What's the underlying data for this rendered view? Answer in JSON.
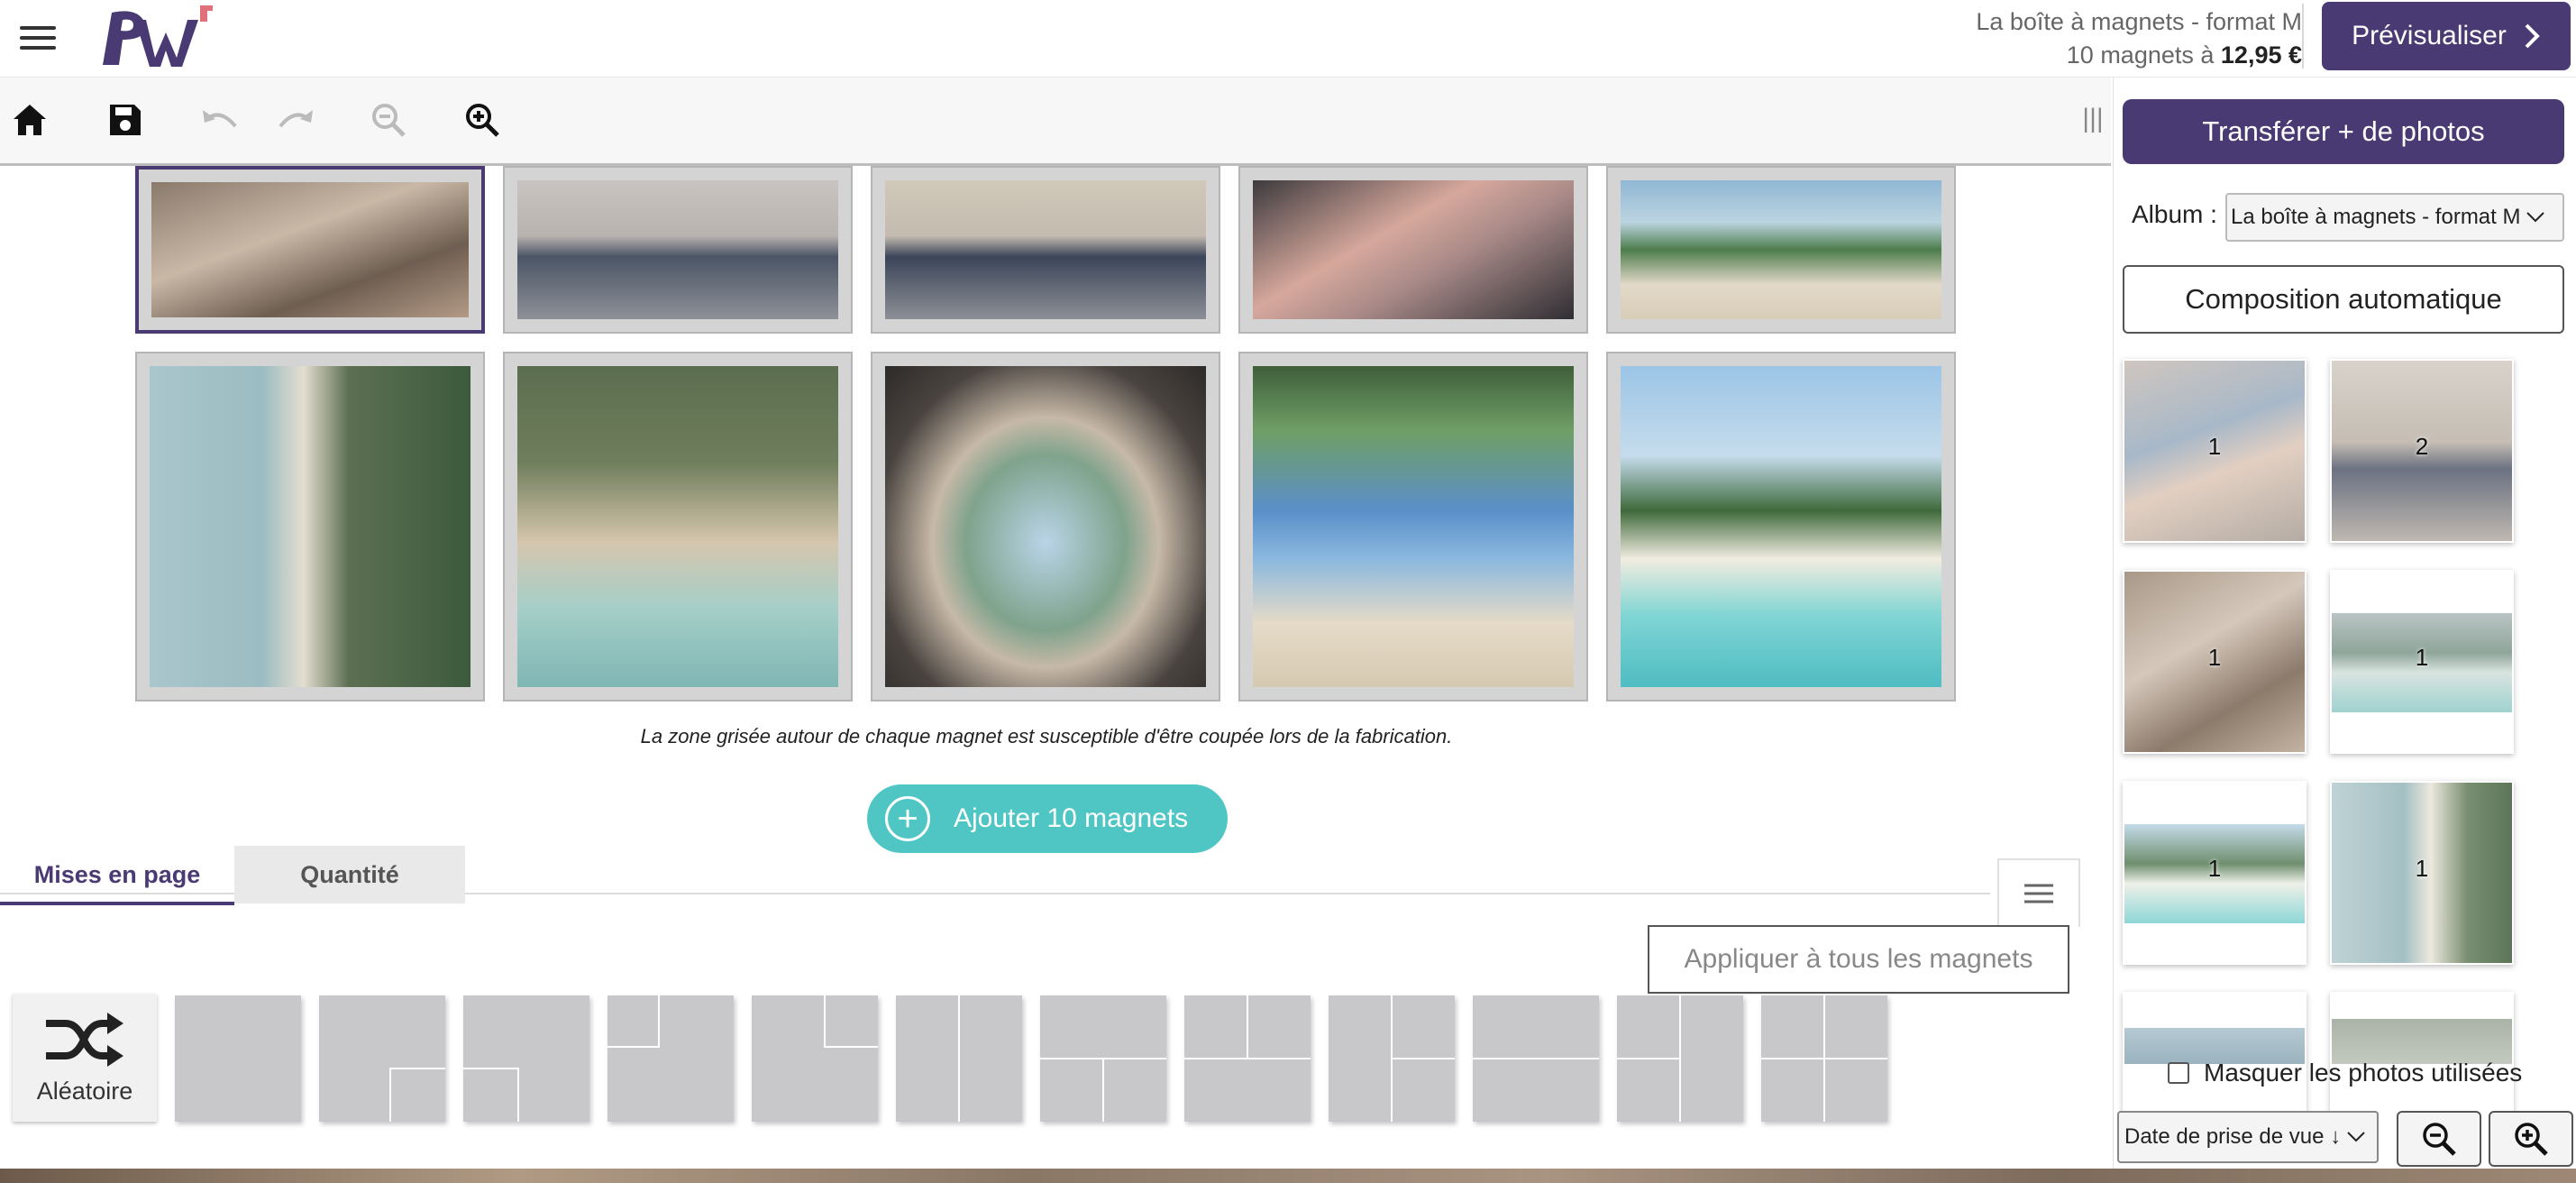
{
  "header": {
    "product_name": "La boîte à magnets - format M",
    "price_prefix": "10 magnets à ",
    "price": "12,95 €",
    "preview_label": "Prévisualiser"
  },
  "toolbar": {
    "icons": [
      "home-icon",
      "save-icon",
      "undo-icon",
      "redo-icon",
      "zoom-out-icon",
      "zoom-in-icon"
    ]
  },
  "canvas": {
    "notice": "La zone grisée autour de chaque magnet est susceptible d'être coupée lors de la fabrication.",
    "add_button_label": "Ajouter 10 magnets"
  },
  "tabs": [
    {
      "label": "Mises en page",
      "active": true
    },
    {
      "label": "Quantité",
      "active": false
    }
  ],
  "layouts": {
    "apply_all_label": "Appliquer à tous les magnets",
    "random_label": "Aléatoire"
  },
  "panel": {
    "transfer_label": "Transférer + de photos",
    "album_label": "Album :",
    "album_value": "La boîte à magnets - format M",
    "compose_label": "Composition automatique",
    "photo_counts": [
      "1",
      "2",
      "1",
      "1",
      "1",
      "1"
    ],
    "hide_used_label": "Masquer les photos utilisées",
    "sort_label": "Date de prise de vue ↓"
  },
  "colors": {
    "brand": "#4a3a73",
    "accent": "#4fc6c4"
  }
}
